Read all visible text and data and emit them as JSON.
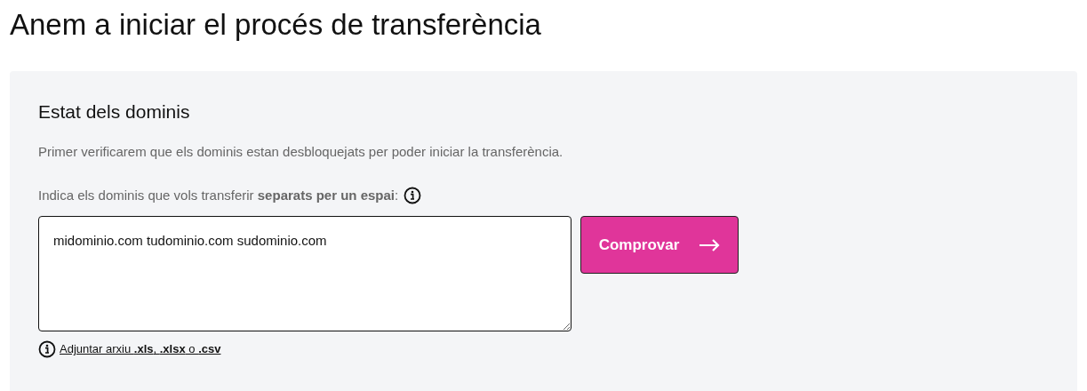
{
  "title": "Anem a iniciar el procés de transferència",
  "panel": {
    "heading": "Estat dels dominis",
    "intro": "Primer verificarem que els dominis estan desbloquejats per poder iniciar la transferència.",
    "label": "Indica els dominis que vols transferir **separats per un espai**:",
    "domains_value": "midominio.com tudominio.com sudominio.com",
    "check_button": "Comprovar",
    "attach_link": "Adjuntar arxiu **.xls**, **.xlsx** o **.csv**"
  }
}
